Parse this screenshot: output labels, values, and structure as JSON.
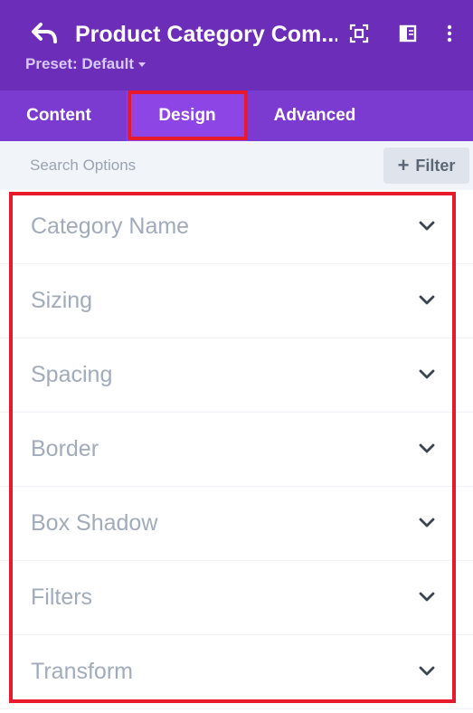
{
  "header": {
    "title": "Product Category Com...",
    "preset_label": "Preset: Default",
    "icons": [
      "back-icon",
      "focus-icon",
      "split-view-icon",
      "more-vertical-icon"
    ]
  },
  "tabs": [
    {
      "label": "Content",
      "active": false
    },
    {
      "label": "Design",
      "active": true
    },
    {
      "label": "Advanced",
      "active": false
    }
  ],
  "search": {
    "placeholder": "Search Options",
    "value": "",
    "filter_label": "Filter"
  },
  "groups": [
    {
      "label": "Category Name"
    },
    {
      "label": "Sizing"
    },
    {
      "label": "Spacing"
    },
    {
      "label": "Border"
    },
    {
      "label": "Box Shadow"
    },
    {
      "label": "Filters"
    },
    {
      "label": "Transform"
    }
  ],
  "colors": {
    "header_bg": "#6c2eb9",
    "tabs_bg": "#7b3bd0",
    "active_tab_bg": "#8d45e6",
    "highlight": "#e8192c",
    "group_label": "#a1abba"
  }
}
